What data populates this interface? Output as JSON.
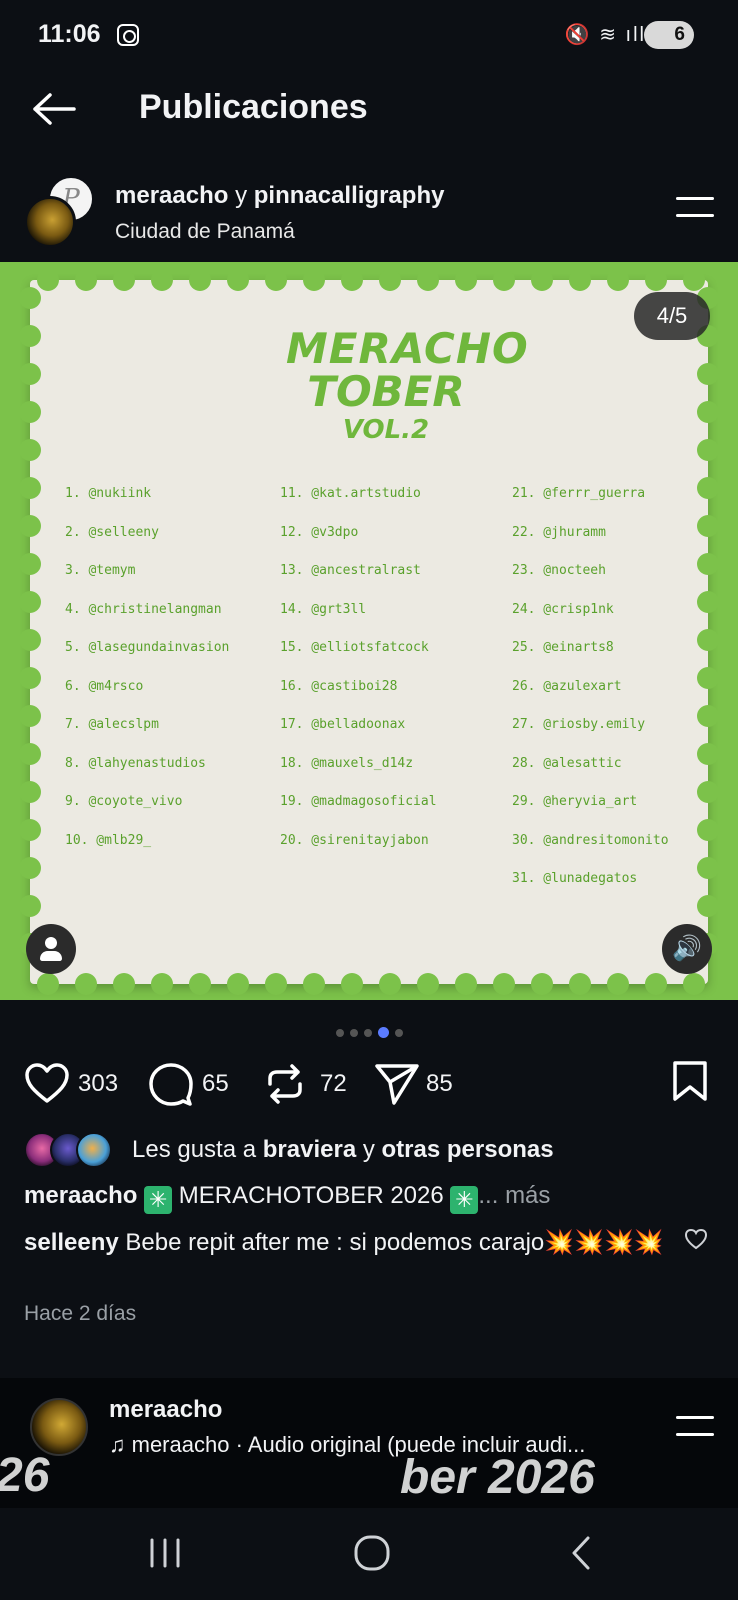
{
  "status_bar": {
    "time": "11:06",
    "signal_icons": "🔇 ≋ ıll",
    "battery": "6"
  },
  "header": {
    "title": "Publicaciones"
  },
  "post": {
    "user_primary": "meraacho",
    "user_join": "y",
    "user_secondary": "pinnacalligraphy",
    "location": "Ciudad de Panamá",
    "page_counter": "4/5",
    "artwork": {
      "logo_line1": "MERACHO",
      "logo_line2": "TOBER",
      "logo_line3": "VOL.2",
      "col1": [
        "1. @nukiink",
        "2. @selleeny",
        "3. @temym",
        "4. @christinelangman",
        "5. @lasegundainvasion",
        "6. @m4rsco",
        "7. @alecslpm",
        "8. @lahyenastudios",
        "9. @coyote_vivo",
        "10. @mlb29_"
      ],
      "col2": [
        "11. @kat.artstudio",
        "12. @v3dpo",
        "13. @ancestralrast",
        "14. @grt3ll",
        "15. @elliotsfatcock",
        "16. @castiboi28",
        "17. @belladoonax",
        "18. @mauxels_d14z",
        "19. @madmagosoficial",
        "20. @sirenitayjabon"
      ],
      "col3": [
        "21. @ferrr_guerra",
        "22. @jhuramm",
        "23. @nocteeh",
        "24. @crisp1nk",
        "25. @einarts8",
        "26. @azulexart",
        "27. @riosby.emily",
        "28. @alesattic",
        "29. @heryvia_art",
        "30. @andresitomonito",
        "31. @lunadegatos"
      ]
    },
    "carousel": {
      "total": 5,
      "active_index": 3
    },
    "actions": {
      "likes": "303",
      "comments": "65",
      "reposts": "72",
      "shares": "85"
    },
    "liked_by": {
      "prefix": "Les gusta a",
      "user": "braviera",
      "join": "y",
      "others": "otras personas"
    },
    "caption": {
      "user": "meraacho",
      "text": "MERACHOTOBER 2026",
      "more": "... más"
    },
    "top_comment": {
      "user": "selleeny",
      "text": "Bebe repit after me : si podemos carajo💥💥💥💥"
    },
    "time_ago": "Hace 2 días"
  },
  "next_post": {
    "user": "meraacho",
    "audio": "meraacho · Audio original (puede incluir audi...",
    "bg_text_left": "26",
    "bg_text_right": "ber 2026"
  },
  "colors": {
    "accent_green": "#7cc24a",
    "dot_active": "#5b7cff",
    "background": "#0c0f14"
  }
}
